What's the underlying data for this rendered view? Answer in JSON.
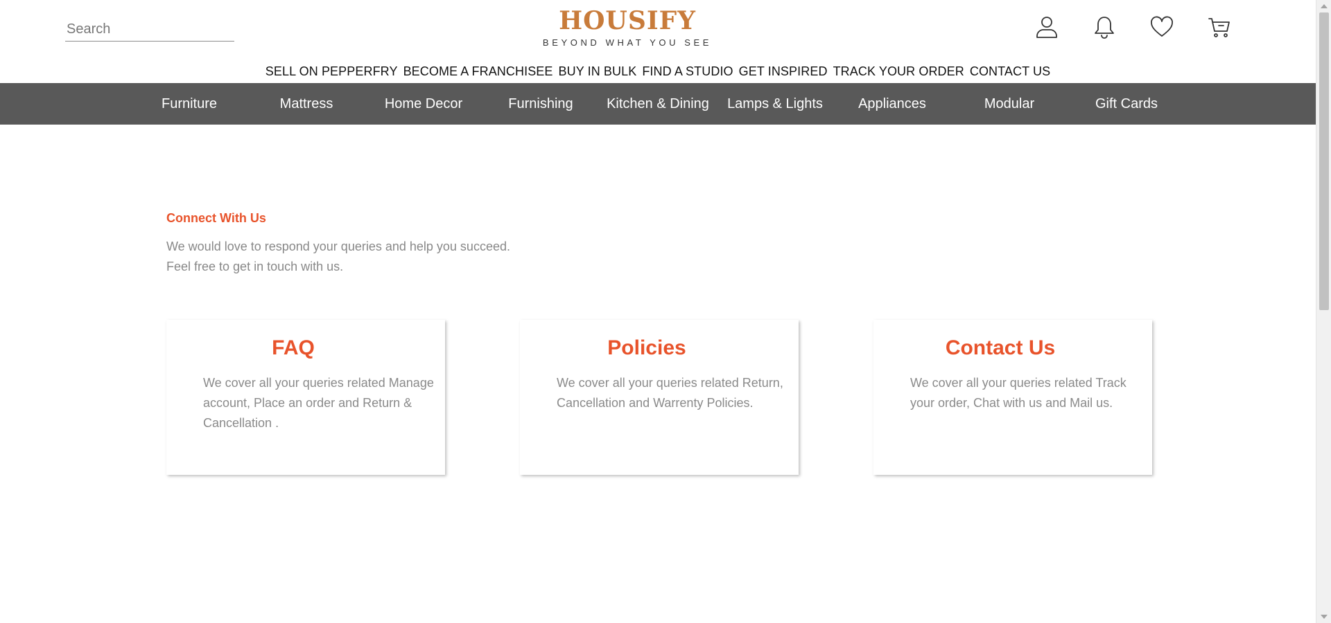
{
  "header": {
    "search_placeholder": "Search",
    "logo_name": "HOUSIFY",
    "logo_tagline": "BEYOND WHAT YOU SEE",
    "icons": [
      "user-icon",
      "bell-icon",
      "heart-icon",
      "cart-icon"
    ]
  },
  "top_links": [
    "SELL ON PEPPERFRY",
    "BECOME A FRANCHISEE",
    "BUY IN BULK",
    "FIND A STUDIO",
    "GET INSPIRED",
    "TRACK YOUR ORDER",
    "CONTACT US"
  ],
  "categories": [
    "Furniture",
    "Mattress",
    "Home Decor",
    "Furnishing",
    "Kitchen & Dining",
    "Lamps & Lights",
    "Appliances",
    "Modular",
    "Gift Cards"
  ],
  "connect": {
    "title": "Connect With Us",
    "line1": "We would love to respond your queries and help you succeed.",
    "line2": "Feel free to get in touch with us."
  },
  "cards": [
    {
      "title": "FAQ",
      "description": "We cover all your queries related Manage account, Place an order and Return & Cancellation ."
    },
    {
      "title": "Policies",
      "description": "We cover all your queries related Return, Cancellation and Warrenty Policies."
    },
    {
      "title": "Contact Us",
      "description": "We cover all your queries related Track your order, Chat with us and Mail us."
    }
  ],
  "colors": {
    "brand": "#c87b3a",
    "accent": "#e8532b",
    "nav_background": "#595959",
    "muted_text": "#888888"
  }
}
